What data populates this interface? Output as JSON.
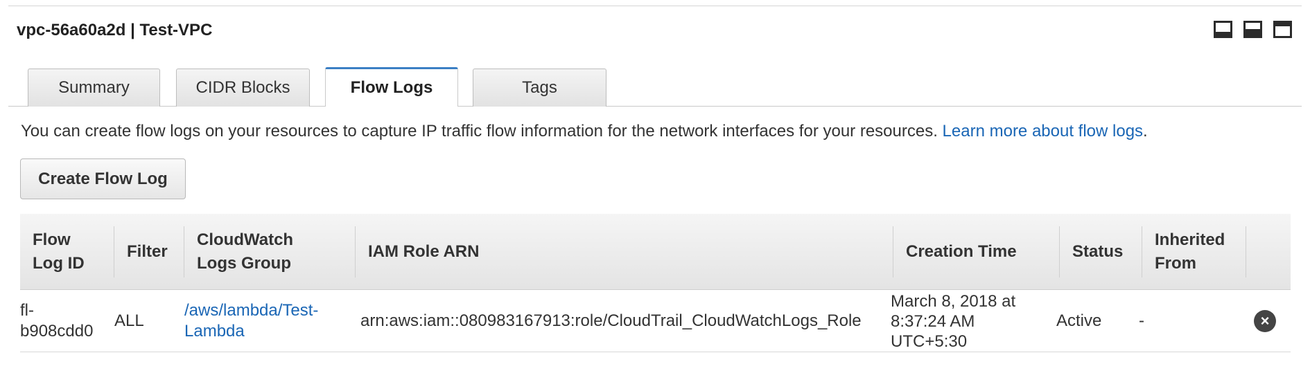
{
  "panel": {
    "title": "vpc-56a60a2d | Test-VPC"
  },
  "layout_icons": [
    "panel-bottom-icon",
    "panel-split-icon",
    "panel-top-icon"
  ],
  "tabs": [
    {
      "label": "Summary",
      "active": false
    },
    {
      "label": "CIDR Blocks",
      "active": false
    },
    {
      "label": "Flow Logs",
      "active": true
    },
    {
      "label": "Tags",
      "active": false
    }
  ],
  "info": {
    "text": "You can create flow logs on your resources to capture IP traffic flow information for the network interfaces for your resources.",
    "link": "Learn more about flow logs",
    "suffix": "."
  },
  "actions": {
    "create_label": "Create Flow Log"
  },
  "table": {
    "headers": {
      "flow_log_id": "Flow\nLog ID",
      "filter": "Filter",
      "log_group": "CloudWatch\nLogs Group",
      "iam_role": "IAM Role ARN",
      "creation_time": "Creation Time",
      "status": "Status",
      "inherited": "Inherited\nFrom"
    },
    "rows": [
      {
        "flow_log_id": "fl-\nb908cdd0",
        "filter": "ALL",
        "log_group": "/aws/lambda/Test-\nLambda",
        "iam_role": "arn:aws:iam::080983167913:role/CloudTrail_CloudWatchLogs_Role",
        "creation_time": "March 8, 2018 at\n8:37:24 AM\nUTC+5:30",
        "status": "Active",
        "inherited": "-",
        "action_icon": "delete-circle-icon"
      }
    ]
  },
  "colors": {
    "link": "#1a66b5",
    "active_tab_accent": "#3b7fc4"
  }
}
